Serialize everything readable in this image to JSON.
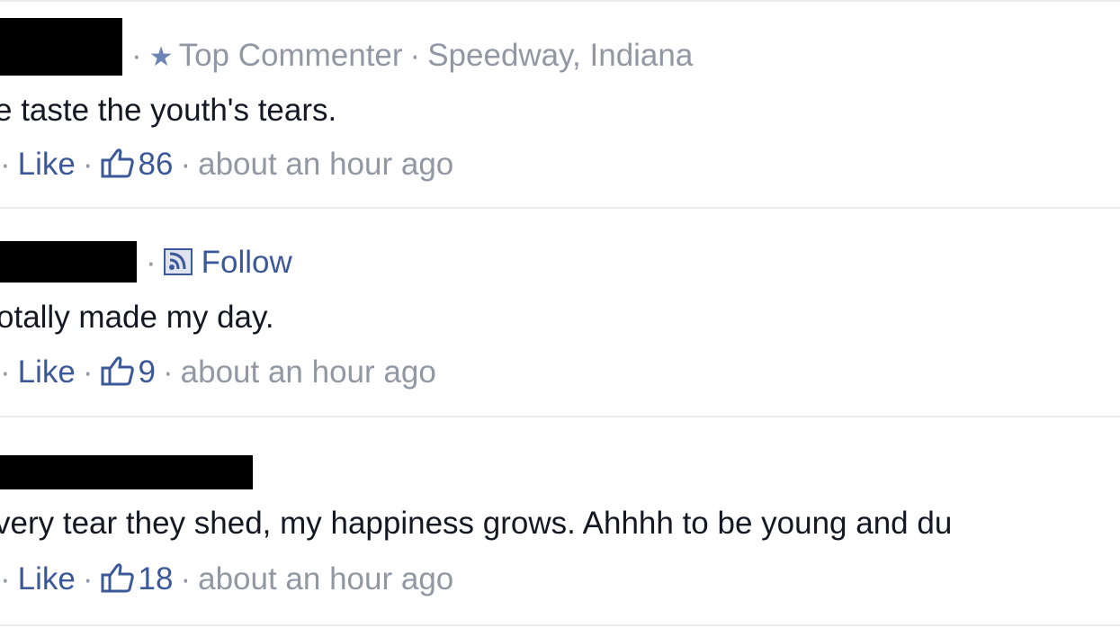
{
  "comments": [
    {
      "meta": {
        "badge": "Top Commenter",
        "location": "Speedway, Indiana"
      },
      "text": "e taste the youth's tears.",
      "actions": {
        "like": "Like",
        "like_count": "86",
        "time": "about an hour ago"
      }
    },
    {
      "meta": {
        "follow": "Follow"
      },
      "text": "otally made my day.",
      "actions": {
        "like": "Like",
        "like_count": "9",
        "time": "about an hour ago"
      }
    },
    {
      "text": "very tear they shed, my happiness grows. Ahhhh to be young and du",
      "actions": {
        "like": "Like",
        "like_count": "18",
        "time": "about an hour ago"
      }
    }
  ],
  "separator": "·",
  "icons": {
    "badge": "star-icon",
    "follow": "rss-icon",
    "like_count": "thumbs-up-icon"
  },
  "colors": {
    "link": "#3b5998",
    "meta": "#9197a3",
    "text": "#141823",
    "divider": "#e9eaed"
  }
}
